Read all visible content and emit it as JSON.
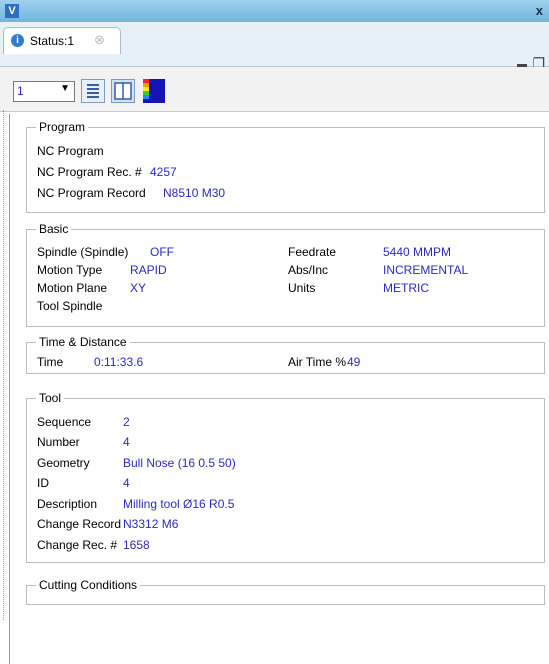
{
  "window": {
    "app_icon": "V",
    "close": "x"
  },
  "tab": {
    "label": "Status:1",
    "close": "⊗"
  },
  "toolbar": {
    "select_value": "1"
  },
  "program": {
    "title": "Program",
    "nc_program": "NC Program",
    "rec_label": "NC Program Rec. #",
    "rec_value": "4257",
    "record_label": "NC Program Record",
    "record_value": "N8510 M30"
  },
  "basic": {
    "title": "Basic",
    "spindle_label": "Spindle (Spindle)",
    "spindle_value": "OFF",
    "motion_type_label": "Motion Type",
    "motion_type_value": "RAPID",
    "motion_plane_label": "Motion Plane",
    "motion_plane_value": "XY",
    "tool_spindle_label": "Tool Spindle",
    "feedrate_label": "Feedrate",
    "feedrate_value": "5440 MMPM",
    "absinc_label": "Abs/Inc",
    "absinc_value": "INCREMENTAL",
    "units_label": "Units",
    "units_value": "METRIC"
  },
  "time": {
    "title": "Time & Distance",
    "time_label": "Time",
    "time_value": "0:11:33.6",
    "air_label": "Air Time %",
    "air_value": "49"
  },
  "tool": {
    "title": "Tool",
    "sequence_label": "Sequence",
    "sequence_value": "2",
    "number_label": "Number",
    "number_value": "4",
    "geometry_label": "Geometry",
    "geometry_value": "Bull Nose (16 0.5 50)",
    "id_label": "ID",
    "id_value": "4",
    "description_label": "Description",
    "description_value": "Milling tool Ø16 R0.5",
    "change_record_label": "Change Record",
    "change_record_value": "N3312 M6",
    "change_rec_label": "Change Rec. #",
    "change_rec_value": "1658"
  },
  "cutting": {
    "title": "Cutting Conditions"
  }
}
